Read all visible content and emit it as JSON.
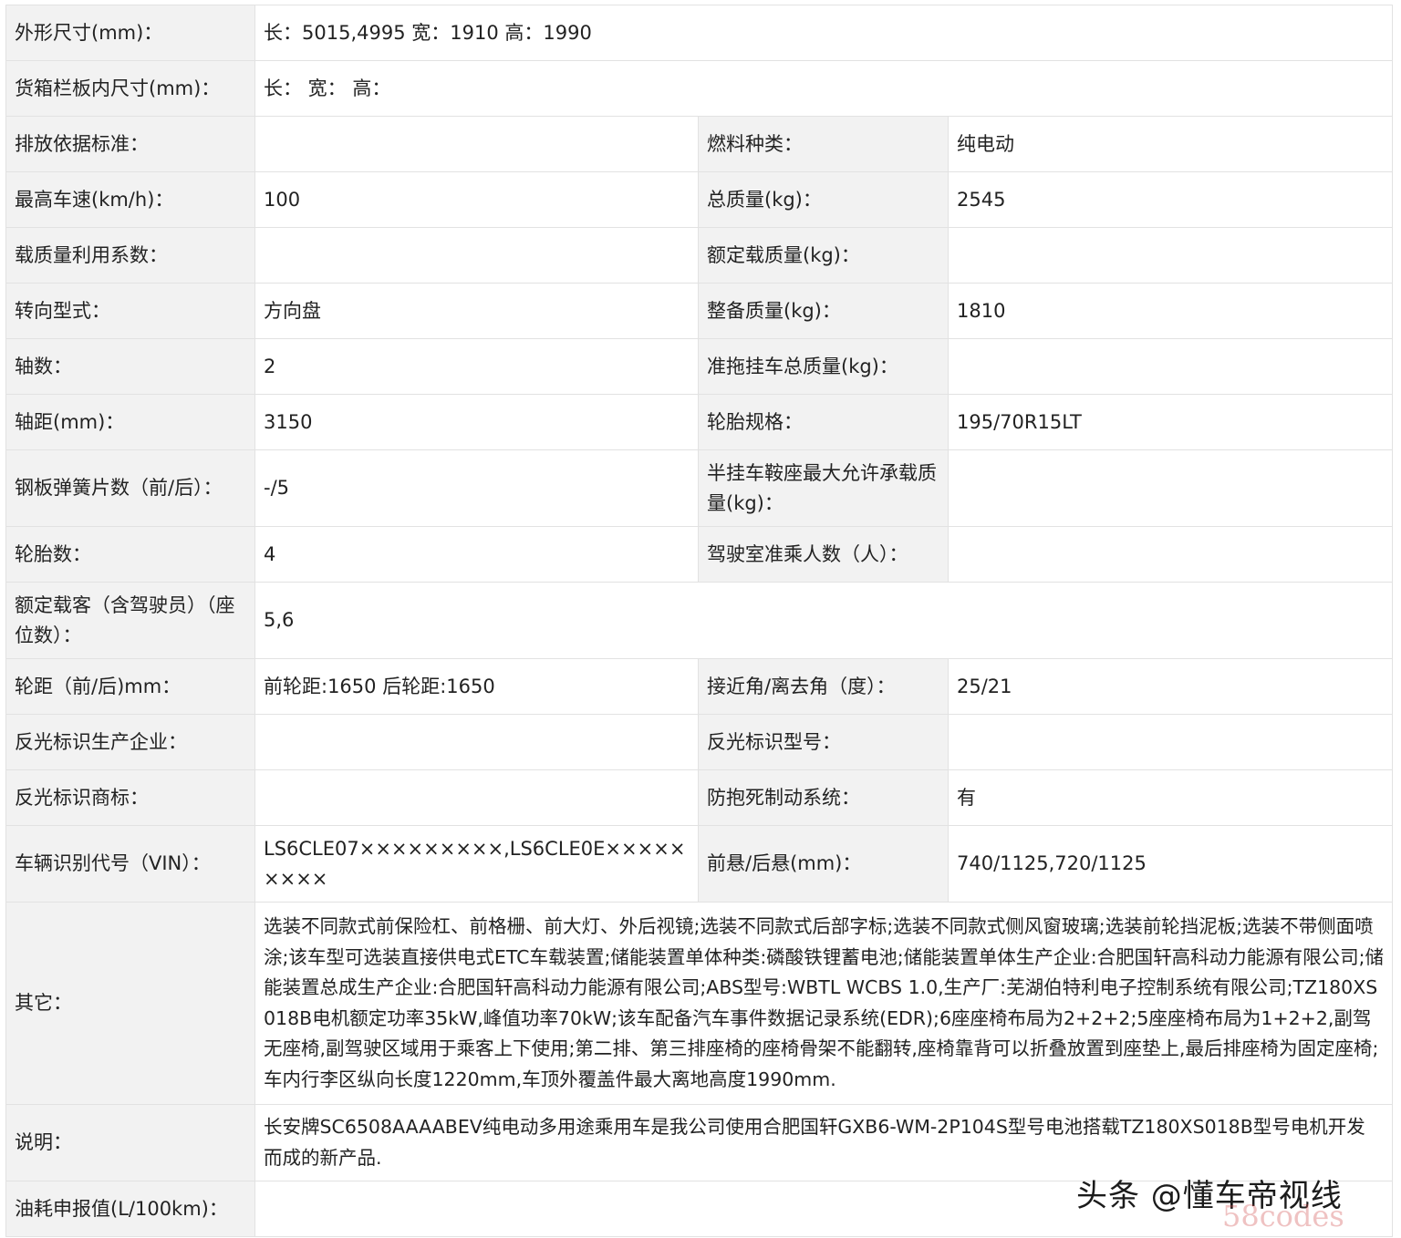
{
  "rows": [
    {
      "label": "外形尺寸(mm)：",
      "value": "长：5015,4995 宽：1910 高：1990"
    },
    {
      "label": "货箱栏板内尺寸(mm)：",
      "value": "长： 宽： 高："
    },
    {
      "label": "排放依据标准：",
      "value": "",
      "label2": "燃料种类：",
      "value2": "纯电动"
    },
    {
      "label": "最高车速(km/h)：",
      "value": "100",
      "label2": "总质量(kg)：",
      "value2": "2545"
    },
    {
      "label": "载质量利用系数：",
      "value": "",
      "label2": "额定载质量(kg)：",
      "value2": ""
    },
    {
      "label": "转向型式：",
      "value": "方向盘",
      "label2": "整备质量(kg)：",
      "value2": "1810"
    },
    {
      "label": "轴数：",
      "value": "2",
      "label2": "准拖挂车总质量(kg)：",
      "value2": ""
    },
    {
      "label": "轴距(mm)：",
      "value": "3150",
      "label2": "轮胎规格：",
      "value2": "195/70R15LT"
    },
    {
      "label": "钢板弹簧片数（前/后）：",
      "value": "-/5",
      "label2": "半挂车鞍座最大允许承载质量(kg)：",
      "value2": ""
    },
    {
      "label": "轮胎数：",
      "value": "4",
      "label2": "驾驶室准乘人数（人）：",
      "value2": ""
    },
    {
      "label": "额定载客（含驾驶员）（座位数）：",
      "value": "5,6"
    },
    {
      "label": "轮距（前/后)mm：",
      "value": "前轮距:1650 后轮距:1650",
      "label2": "接近角/离去角（度）：",
      "value2": "25/21"
    },
    {
      "label": "反光标识生产企业：",
      "value": "",
      "label2": "反光标识型号：",
      "value2": ""
    },
    {
      "label": "反光标识商标：",
      "value": "",
      "label2": "防抱死制动系统：",
      "value2": "有"
    },
    {
      "label": "车辆识别代号（VIN）：",
      "value": "LS6CLE07×××××××××,LS6CLE0E×××××××××",
      "label2": "前悬/后悬(mm)：",
      "value2": "740/1125,720/1125"
    },
    {
      "label": "其它：",
      "value": "选装不同款式前保险杠、前格栅、前大灯、外后视镜;选装不同款式后部字标;选装不同款式侧风窗玻璃;选装前轮挡泥板;选装不带侧面喷涂;该车型可选装直接供电式ETC车载装置;储能装置单体种类:磷酸铁锂蓄电池;储能装置单体生产企业:合肥国轩高科动力能源有限公司;储能装置总成生产企业:合肥国轩高科动力能源有限公司;ABS型号:WBTL WCBS 1.0,生产厂:芜湖伯特利电子控制系统有限公司;TZ180XS018B电机额定功率35kW,峰值功率70kW;该车配备汽车事件数据记录系统(EDR);6座座椅布局为2+2+2;5座座椅布局为1+2+2,副驾无座椅,副驾驶区域用于乘客上下使用;第二排、第三排座椅的座椅骨架不能翻转,座椅靠背可以折叠放置到座垫上,最后排座椅为固定座椅;车内行李区纵向长度1220mm,车顶外覆盖件最大离地高度1990mm."
    },
    {
      "label": "说明：",
      "value": "长安牌SC6508AAAABEV纯电动多用途乘用车是我公司使用合肥国轩GXB6-WM-2P104S型号电池搭载TZ180XS018B型号电机开发而成的新产品."
    },
    {
      "label": "油耗申报值(L/100km)：",
      "value": ""
    }
  ],
  "watermark": {
    "text": "头条 @懂车帝视线",
    "site": "58codes"
  },
  "colors": {
    "label_bg": "#f2f2f2",
    "border": "#e2e2e2",
    "text": "#222222"
  }
}
